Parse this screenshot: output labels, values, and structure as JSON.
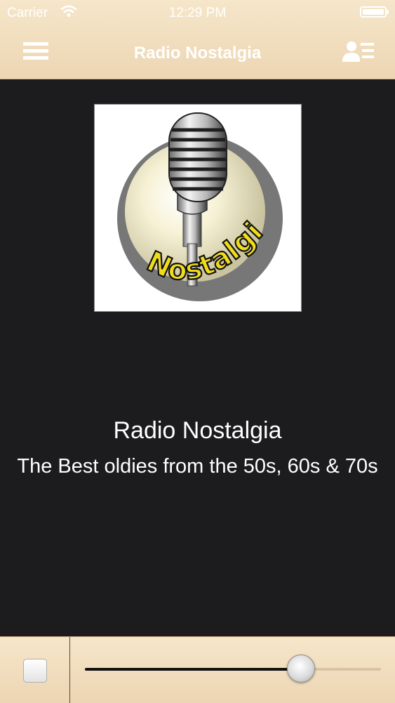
{
  "status_bar": {
    "carrier": "Carrier",
    "time": "12:29 PM",
    "wifi_icon": "wifi-icon",
    "battery_icon": "battery-icon"
  },
  "nav_bar": {
    "title": "Radio Nostalgia",
    "menu_icon": "hamburger-menu-icon",
    "contact_icon": "contact-list-icon"
  },
  "station": {
    "logo_text": "Nostalgia",
    "name": "Radio Nostalgia",
    "description": "The Best oldies from the 50s, 60s & 70s"
  },
  "player": {
    "stop_icon": "stop-icon",
    "volume_level": 0.73
  },
  "colors": {
    "bar_background": "#f2dfc0",
    "content_background": "#1c1b1d",
    "text": "#ffffff",
    "logo_yellow": "#f1dc1b"
  }
}
